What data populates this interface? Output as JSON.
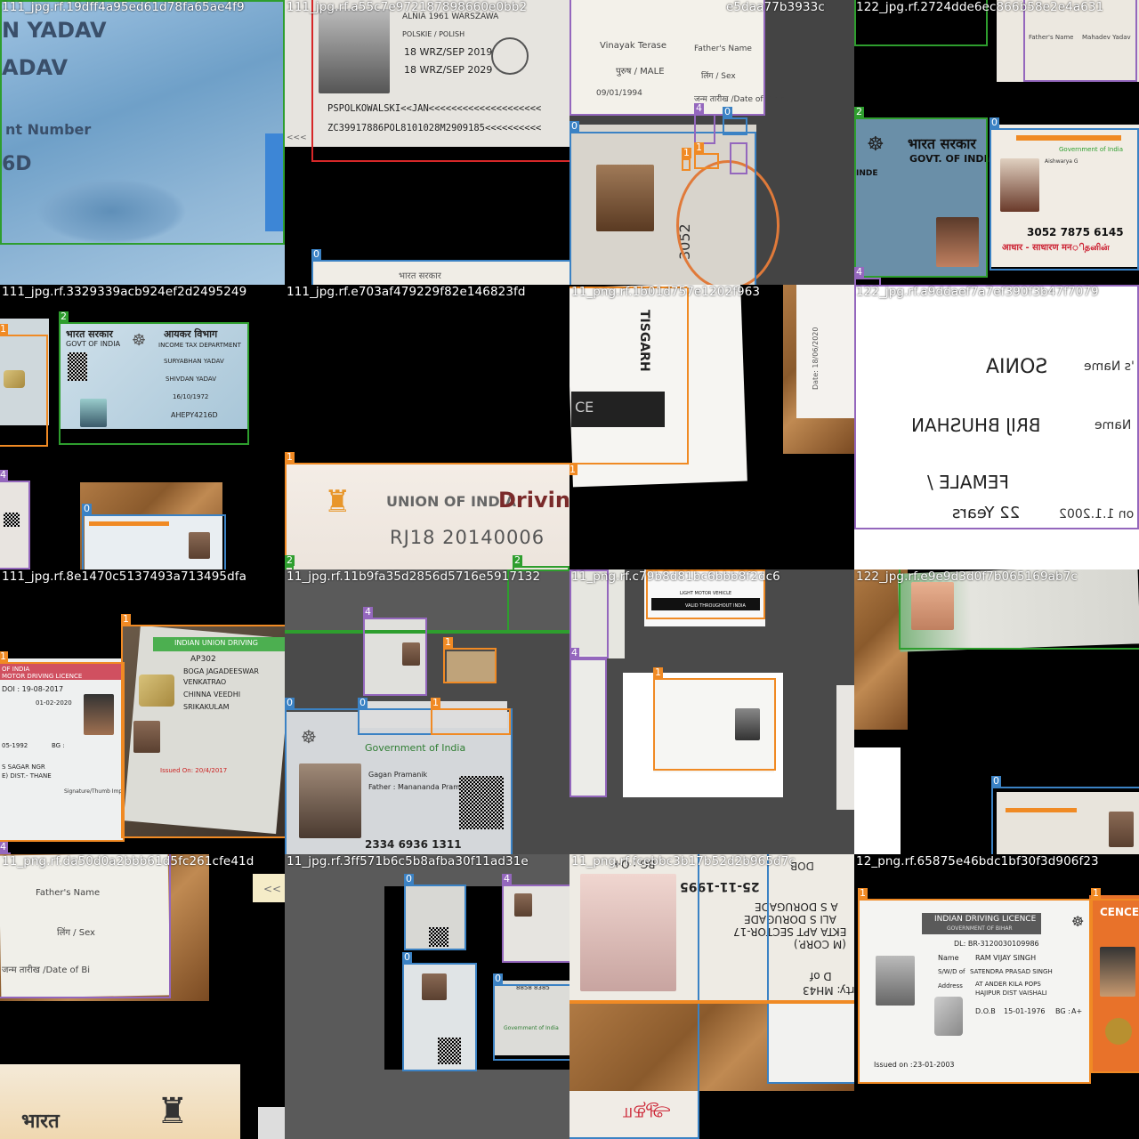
{
  "colors": {
    "class_0": "#3b82c4",
    "class_1": "#f08a24",
    "class_2": "#2e9e2e",
    "class_3": "#d62728",
    "class_4": "#9467bd"
  },
  "tiles": [
    {
      "title": "111_jpg.rf.19dff4a95ed61d78fa65ae4f9",
      "texts": {
        "a": "N YADAV",
        "b": "ADAV",
        "c": "nt Number",
        "d": "6D"
      }
    },
    {
      "title": "111_jpg.rf.a55c7e972187898660e0bb2",
      "texts": {
        "a": "ALNIA 1961  WARSZAWA",
        "b": "POLSKIE / POLISH",
        "c": "18 WRZ/SEP 2019",
        "d": "18 WRZ/SEP 2029",
        "e": "PSPOLKOWALSKI<<JAN<<<<<<<<<<<<<<<<<<<<",
        "f": "ZC39917886POL8101028M2909185<<<<<<<<<<",
        "g": "<<<",
        "h": "भारत सरकार"
      }
    },
    {
      "title": "e5daa77b3933c",
      "texts": {
        "a": "Father's Name",
        "b": "Vinayak Terase",
        "c": "पुरुष / MALE",
        "d": "लिंग / Sex",
        "e": "09/01/1994",
        "f": "जन्म तारीख /Date of Birth",
        "g": "3052"
      }
    },
    {
      "title": "122_jpg.rf.2724dde6ec866b58e2e4a631",
      "texts": {
        "a": "भारत सरकार",
        "b": "GOVT. OF INDIA",
        "c": "INDE",
        "d": "Government of India",
        "e": "Aishwarya G",
        "f": "3052 7875 6145",
        "g": "आधार - साधारण मनிதனின்",
        "h": "Father's Name",
        "i": "Mahadev Yadav"
      }
    },
    {
      "title": "111_jpg.rf.3329339acb924ef2d2495249",
      "texts": {
        "a": "आयकर विभाग",
        "b": "INCOME TAX DEPARTMENT",
        "c": "भारत सरकार",
        "d": "GOVT OF INDIA",
        "e": "SURYABHAN YADAV",
        "f": "SHIVDAN YADAV",
        "g": "16/10/1972",
        "h": "AHEPY4216D"
      }
    },
    {
      "title": "111_jpg.rf.e703af479229f82e146823fd",
      "texts": {
        "a": "UNION OF INDIA",
        "b": "Drivin",
        "c": "RJ18  20140006"
      }
    },
    {
      "title": "11_png.rf.1b01d757e1202f963",
      "texts": {
        "a": "TISGARH",
        "b": "CE",
        "c": "Date: 18/06/2020"
      }
    },
    {
      "title": "122_jpg.rf.a9ddaef7a7ef390f3b47f7079",
      "texts": {
        "a": "SONIA",
        "b": "BRIJ BHUSHAN",
        "c": "FEMALE /",
        "d": "22  Years",
        "e": "on 1.1.2002",
        "f": "'s Name",
        "g": "Name"
      }
    },
    {
      "title": "111_jpg.rf.8e1470c5137493a713495dfa",
      "texts": {
        "a": "OF INDIA",
        "b": "MOTOR DRIVING LICENCE",
        "c": "DOI : 19-08-2017",
        "d": "01-02-2020",
        "e": "05-1992",
        "f": "BG :",
        "g": "S SAGAR NGR",
        "h": "E) DIST.- THANE",
        "i": "INDIAN UNION DRIVING",
        "j": "AP302",
        "k": "BOGA JAGADEESWAR",
        "l": "VENKATRAO",
        "m": "CHINNA VEEDHI",
        "n": "SRIKAKULAM",
        "o": "Issued On: 20/4/2017",
        "p": "Signature/Thumb Impression of Holder"
      }
    },
    {
      "title": "11_jpg.rf.11b9fa35d2856d5716e5917132",
      "texts": {
        "a": "Government of India",
        "b": "Gagan Pramanik",
        "c": "Father : Manananda Pramanik",
        "d": "2334 6936 1311"
      }
    },
    {
      "title": "11_png.rf.c79b8d81bc6bbb8f2dc6",
      "texts": {
        "a": "LIGHT MOTOR VEHICLE",
        "b": "VALID THROUGHOUT INDIA"
      }
    },
    {
      "title": "122_jpg.rf.e9e9d3d0f7b065169ab7c",
      "texts": {}
    },
    {
      "title": "11_png.rf.da50d0a2bbb61d5fc261cfe41d",
      "texts": {
        "a": "Father's Name",
        "b": "लिंग / Sex",
        "c": "जन्म तारीख /Date of Bi",
        "d": "भारत",
        "e": "<<"
      }
    },
    {
      "title": "11_jpg.rf.3ff571b6c5b8afba30f11ad31e",
      "texts": {
        "a": "8858 8385",
        "b": "Government of India"
      }
    },
    {
      "title": "11_png.rf.fcebbc3b17b52d2b965d7c",
      "texts": {
        "a": "DOB",
        "b": "BG : O+",
        "c": "25-11-1995",
        "d": "A S DORUGADE",
        "e": "ALI S DORUGADE",
        "f": "EKTA APT SECTOR-17",
        "g": "(M CORP.)",
        "h": "D of",
        "i": "rty: MH43",
        "j": "ஆதா"
      }
    },
    {
      "title": "12_png.rf.65875e46bdc1bf30f3d906f23",
      "texts": {
        "a": "INDIAN DRIVING LICENCE",
        "b": "GOVERNMENT OF BIHAR",
        "c": "DL: BR-3120030109986",
        "d": "Name",
        "e": "RAM VIJAY SINGH",
        "f": "S/W/D of",
        "g": "SATENDRA PRASAD SINGH",
        "h": "Address",
        "i": "AT ANDER KILA POPS",
        "j": "HAJIPUR DIST VAISHALI",
        "k": "D.O.B",
        "l": "15-01-1976",
        "m": "BG :",
        "n": "A+",
        "o": "Issued on :",
        "p": "23-01-2003",
        "q": "CENCE"
      }
    }
  ],
  "box_labels": [
    "0",
    "1",
    "2",
    "3",
    "4"
  ]
}
